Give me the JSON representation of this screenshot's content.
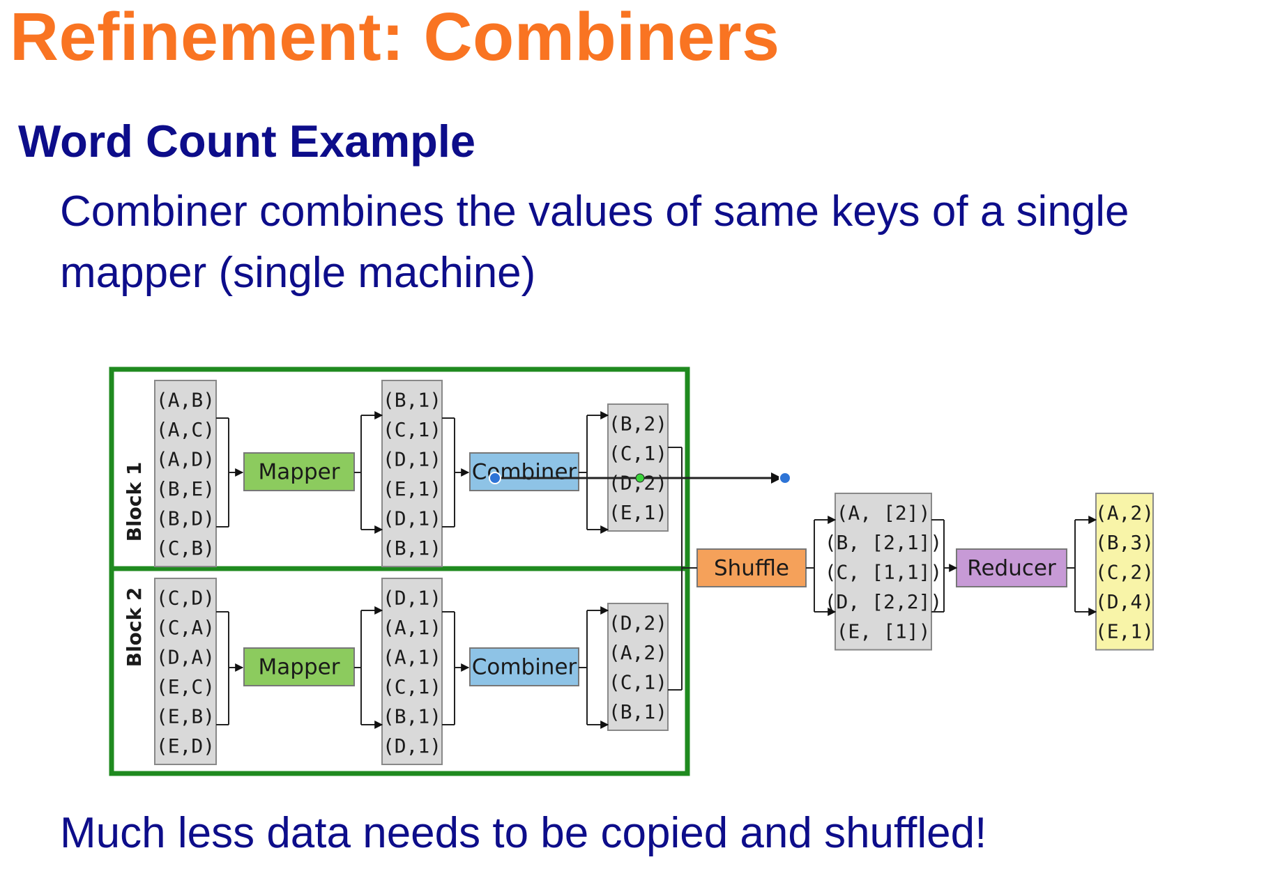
{
  "title": "Refinement: Combiners",
  "subtitle": "Word Count Example",
  "text_line_1": "Combiner combines the values of same keys of a single",
  "text_line_2": "mapper (single machine)",
  "text_bottom": "Much less data needs to be copied and shuffled!",
  "diagram": {
    "block1_label": "Block 1",
    "block2_label": "Block 2",
    "mapper_label": "Mapper",
    "combiner_label": "Combiner",
    "shuffle_label": "Shuffle",
    "reducer_label": "Reducer",
    "block1_input": [
      "(A,B)",
      "(A,C)",
      "(A,D)",
      "(B,E)",
      "(B,D)",
      "(C,B)"
    ],
    "block2_input": [
      "(C,D)",
      "(C,A)",
      "(D,A)",
      "(E,C)",
      "(E,B)",
      "(E,D)"
    ],
    "block1_mapped": [
      "(B,1)",
      "(C,1)",
      "(D,1)",
      "(E,1)",
      "(D,1)",
      "(B,1)"
    ],
    "block2_mapped": [
      "(D,1)",
      "(A,1)",
      "(A,1)",
      "(C,1)",
      "(B,1)",
      "(D,1)"
    ],
    "block1_combined": [
      "(B,2)",
      "(C,1)",
      "(D,2)",
      "(E,1)"
    ],
    "block2_combined": [
      "(D,2)",
      "(A,2)",
      "(C,1)",
      "(B,1)"
    ],
    "shuffled": [
      "(A, [2])",
      "(B, [2,1])",
      "(C, [1,1])",
      "(D, [2,2])",
      "(E, [1])"
    ],
    "reduced": [
      "(A,2)",
      "(B,3)",
      "(C,2)",
      "(D,4)",
      "(E,1)"
    ],
    "colors": {
      "mapper": "#8CCB5E",
      "combiner": "#8EC3E6",
      "shuffle": "#F5A15A",
      "reducer": "#C79AD6",
      "data_box": "#D9D9D9",
      "output_box": "#F8F4A8",
      "block_frame": "#1F8A1F"
    }
  }
}
